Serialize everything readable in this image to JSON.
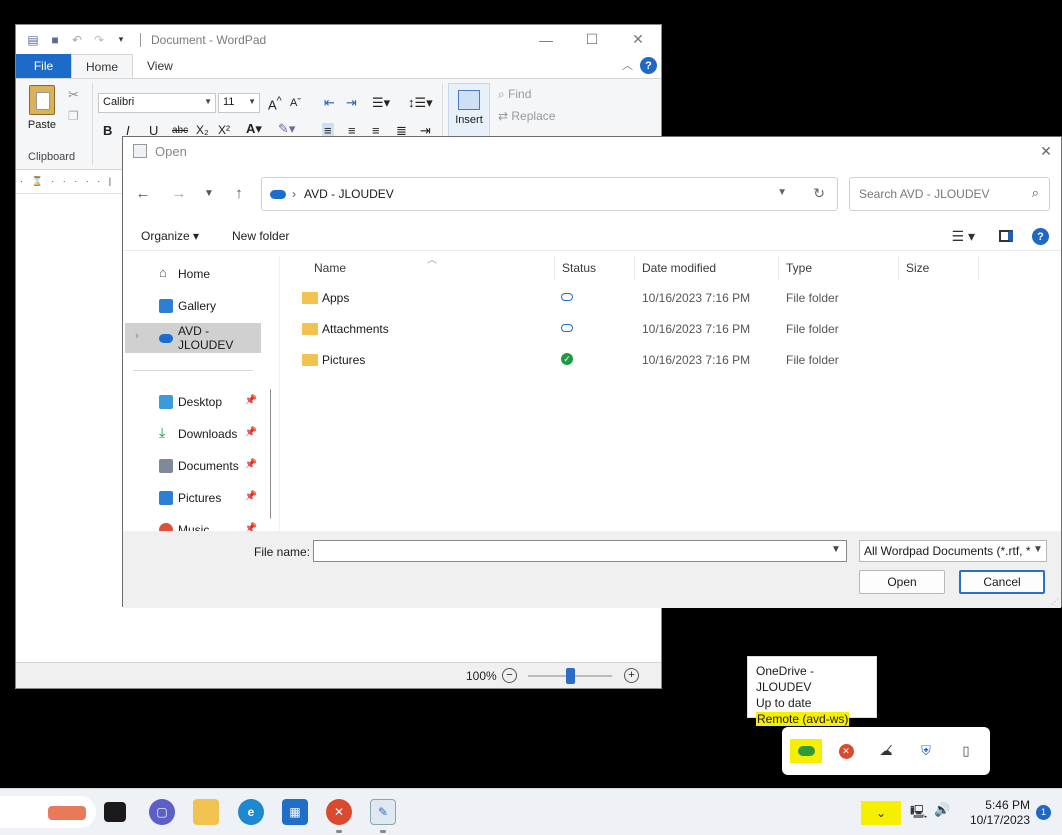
{
  "wordpad": {
    "title": "Document - WordPad",
    "tabs": [
      "File",
      "Home",
      "View"
    ],
    "font_name": "Calibri",
    "font_size": "11",
    "paste_label": "Paste",
    "clipboard_group": "Clipboard",
    "insert_label": "Insert",
    "find_label": "Find",
    "replace_label": "Replace",
    "zoom": "100%"
  },
  "dialog": {
    "title": "Open",
    "breadcrumb": "AVD - JLOUDEV",
    "search_placeholder": "Search AVD - JLOUDEV",
    "organize": "Organize",
    "new_folder": "New folder",
    "nav_items": [
      {
        "label": "Home"
      },
      {
        "label": "Gallery"
      },
      {
        "label": "AVD - JLOUDEV"
      },
      {
        "label": "Desktop"
      },
      {
        "label": "Downloads"
      },
      {
        "label": "Documents"
      },
      {
        "label": "Pictures"
      },
      {
        "label": "Music"
      }
    ],
    "columns": [
      "Name",
      "Status",
      "Date modified",
      "Type",
      "Size"
    ],
    "files": [
      {
        "name": "Apps",
        "status": "cloud",
        "date": "10/16/2023 7:16 PM",
        "type": "File folder"
      },
      {
        "name": "Attachments",
        "status": "cloud",
        "date": "10/16/2023 7:16 PM",
        "type": "File folder"
      },
      {
        "name": "Pictures",
        "status": "synced",
        "date": "10/16/2023 7:16 PM",
        "type": "File folder"
      }
    ],
    "file_name_label": "File name:",
    "file_name_value": "",
    "file_type": "All Wordpad Documents (*.rtf, *",
    "open_button": "Open",
    "cancel_button": "Cancel"
  },
  "tooltip": {
    "line1": "OneDrive - JLOUDEV",
    "line2": "Up to date",
    "line3": "Remote (avd-ws)",
    "highlight_color": "#f6f000"
  },
  "taskbar": {
    "time": "5:46 PM",
    "date": "10/17/2023",
    "notification_count": "1"
  },
  "colors": {
    "accent": "#1c6bc9",
    "onedrive_blue": "#1a6ecf",
    "synced_green": "#1e9a45"
  }
}
